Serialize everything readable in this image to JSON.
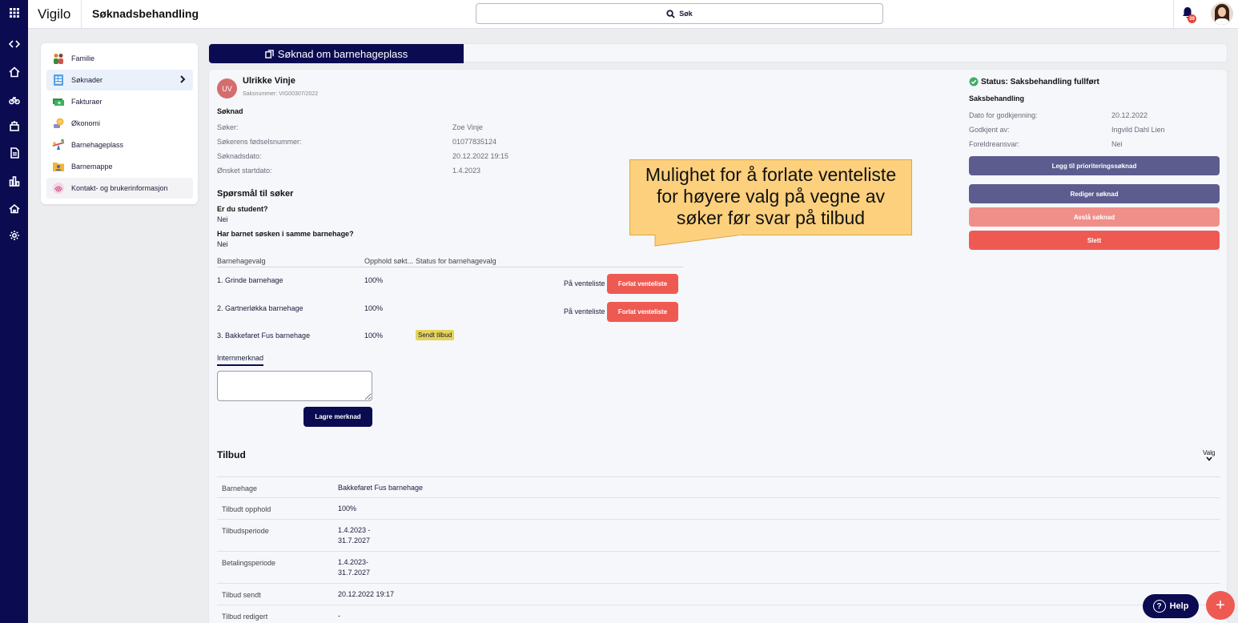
{
  "app": {
    "brand": "Vigilo",
    "page_title": "Søknadsbehandling"
  },
  "search": {
    "label": "Søk"
  },
  "notifications": {
    "count": "39"
  },
  "side_menu": {
    "items": [
      {
        "label": "Familie"
      },
      {
        "label": "Søknader"
      },
      {
        "label": "Fakturaer"
      },
      {
        "label": "Økonomi"
      },
      {
        "label": "Barnehageplass"
      },
      {
        "label": "Barnemappe"
      },
      {
        "label": "Kontakt- og brukerinformasjon"
      }
    ]
  },
  "header_tab": {
    "label": "Søknad om barnehageplass"
  },
  "applicant": {
    "initials": "UV",
    "name": "Ulrikke Vinje",
    "case_number": "Saksnummer: VIG00307/2022"
  },
  "application": {
    "heading": "Søknad",
    "fields": [
      {
        "label": "Søker:",
        "value": "Zoe Vinje"
      },
      {
        "label": "Søkerens fødselsnummer:",
        "value": "01077835124"
      },
      {
        "label": "Søknadsdato:",
        "value": "20.12.2022 19:15"
      },
      {
        "label": "Ønsket startdato:",
        "value": "1.4.2023"
      }
    ]
  },
  "questions": {
    "heading": "Spørsmål til søker",
    "items": [
      {
        "q": "Er du student?",
        "a": "Nei"
      },
      {
        "q": "Har barnet søsken i samme barnehage?",
        "a": "Nei"
      }
    ]
  },
  "choices_table": {
    "headers": [
      "Barnehagevalg",
      "Opphold søkt...",
      "Status for barnehagevalg"
    ],
    "rows": [
      {
        "name": "1. Grinde barnehage",
        "stay": "100%",
        "status": "På venteliste",
        "action": "Forlat venteliste"
      },
      {
        "name": "2. Gartnerløkka barnehage",
        "stay": "100%",
        "status": "På venteliste",
        "action": "Forlat venteliste"
      },
      {
        "name": "3. Bakkefaret Fus barnehage",
        "stay": "100%",
        "badge": "Sendt tilbud"
      }
    ]
  },
  "internal_note": {
    "label": "Internmerknad",
    "value": "",
    "save_label": "Lagre merknad"
  },
  "status_panel": {
    "status": "Status: Saksbehandling fullført",
    "heading": "Saksbehandling",
    "fields": [
      {
        "label": "Dato for godkjenning:",
        "value": "20.12.2022"
      },
      {
        "label": "Godkjent av:",
        "value": "Ingvild Dahl Lien"
      },
      {
        "label": "Foreldreansvar:",
        "value": "Nei"
      }
    ],
    "buttons": {
      "priority": "Legg til prioriteringssøknad",
      "edit": "Rediger søknad",
      "reject": "Avslå søknad",
      "delete": "Slett"
    }
  },
  "callout": {
    "lines": [
      "Mulighet for å forlate venteliste",
      "for høyere valg på vegne av",
      "søker før svar på tilbud"
    ]
  },
  "tilbud": {
    "title": "Tilbud",
    "menu_label": "Valg",
    "rows": [
      {
        "label": "Barnehage",
        "value": [
          "Bakkefaret Fus barnehage"
        ]
      },
      {
        "label": "Tilbudt opphold",
        "value": [
          "100%"
        ]
      },
      {
        "label": "Tilbudsperiode",
        "value": [
          "1.4.2023 -",
          "31.7.2027"
        ]
      },
      {
        "label": "Betalingsperiode",
        "value": [
          "1.4.2023-",
          "31.7.2027"
        ]
      },
      {
        "label": "Tilbud sendt",
        "value": [
          "20.12.2022 19:17"
        ]
      },
      {
        "label": "Tilbud redigert",
        "value": [
          "-"
        ]
      }
    ]
  },
  "help": {
    "label": "Help",
    "icon": "?"
  },
  "fab": {
    "icon": "+"
  },
  "colors": {
    "navy": "#0b0b52",
    "red": "#ee5a52",
    "muted_purple": "#5c5c8e",
    "light_red": "#f08f89",
    "callout": "#fcd07d"
  }
}
